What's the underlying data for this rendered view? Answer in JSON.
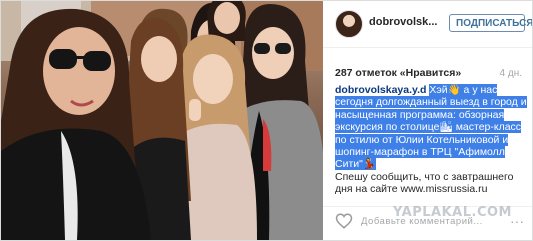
{
  "post": {
    "username": "dobrovolsk...",
    "follow_label": "ПОДПИСАТЬСЯ",
    "likes": "287 отметок «Нравится»",
    "time_ago": "4 дн.",
    "caption_author": "dobrovolskaya.y.d",
    "caption_highlighted": "Хэй👋 а у нас сегодня долгожданный выезд в город и насыщенная программа: обзорная экскурсия по столице🏙 мастер-класс по стилю от Юлии Котельниковой и шопинг-марафон в ТРЦ \"Афимолл Сити\"💃",
    "caption_rest": "Спешу сообщить, что с завтрашнего дня на сайте www.missrussia.ru",
    "comment_placeholder": "Добавьте комментарий...",
    "more_icon": "···",
    "watermark": "YAPLAKAL.COM"
  },
  "colors": {
    "follow_blue": "#3f729b",
    "author_blue": "#0a3882",
    "highlight": "#3f80e8"
  },
  "icons": {
    "heart": "heart-icon",
    "more": "more-options-icon"
  }
}
